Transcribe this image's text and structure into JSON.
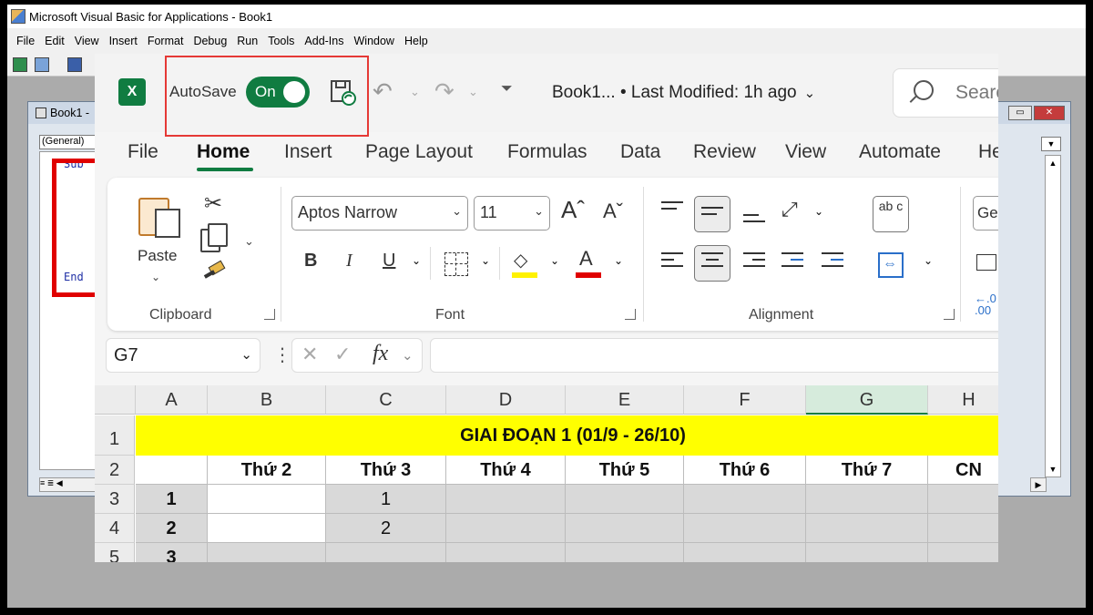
{
  "vbe": {
    "title": "Microsoft Visual Basic for Applications - Book1",
    "menu": [
      "File",
      "Edit",
      "View",
      "Insert",
      "Format",
      "Debug",
      "Run",
      "Tools",
      "Add-Ins",
      "Window",
      "Help"
    ],
    "child_title": "Book1 -",
    "object_combo": "(General)",
    "code_line_1": "Sub",
    "code_line_2": "End"
  },
  "excel": {
    "logo": "X",
    "autosave_label": "AutoSave",
    "autosave_state": "On",
    "doc_title": "Book1...  •  Last Modified: 1h ago",
    "search_placeholder": "Search",
    "tabs": [
      "File",
      "Home",
      "Insert",
      "Page Layout",
      "Formulas",
      "Data",
      "Review",
      "View",
      "Automate",
      "He"
    ],
    "active_tab": "Home",
    "ribbon": {
      "paste_label": "Paste",
      "font_name": "Aptos Narrow",
      "font_size": "11",
      "number_format": "Gen",
      "groups": [
        "Clipboard",
        "Font",
        "Alignment"
      ],
      "wrap_text_glyph": "ab c",
      "decimal_glyph": "←.0 .00"
    },
    "name_box": "G7",
    "formula": "",
    "fx_label": "fx",
    "columns": [
      "A",
      "B",
      "C",
      "D",
      "E",
      "F",
      "G",
      "H"
    ],
    "selected_column": "G",
    "rows": [
      "1",
      "2",
      "3",
      "4",
      "5"
    ],
    "banner": "GIAI ĐOẠN 1 (01/9 - 26/10)",
    "day_headers": [
      "Thứ 2",
      "Thứ 3",
      "Thứ 4",
      "Thứ 5",
      "Thứ 6",
      "Thứ 7",
      "CN"
    ],
    "data_rows": [
      {
        "a": "1",
        "c": "1"
      },
      {
        "a": "2",
        "c": "2"
      },
      {
        "a": "3",
        "c": ""
      }
    ]
  },
  "colors": {
    "excel_green": "#107c41",
    "highlight_red": "#e53935",
    "banner_yellow": "#ffff00"
  }
}
